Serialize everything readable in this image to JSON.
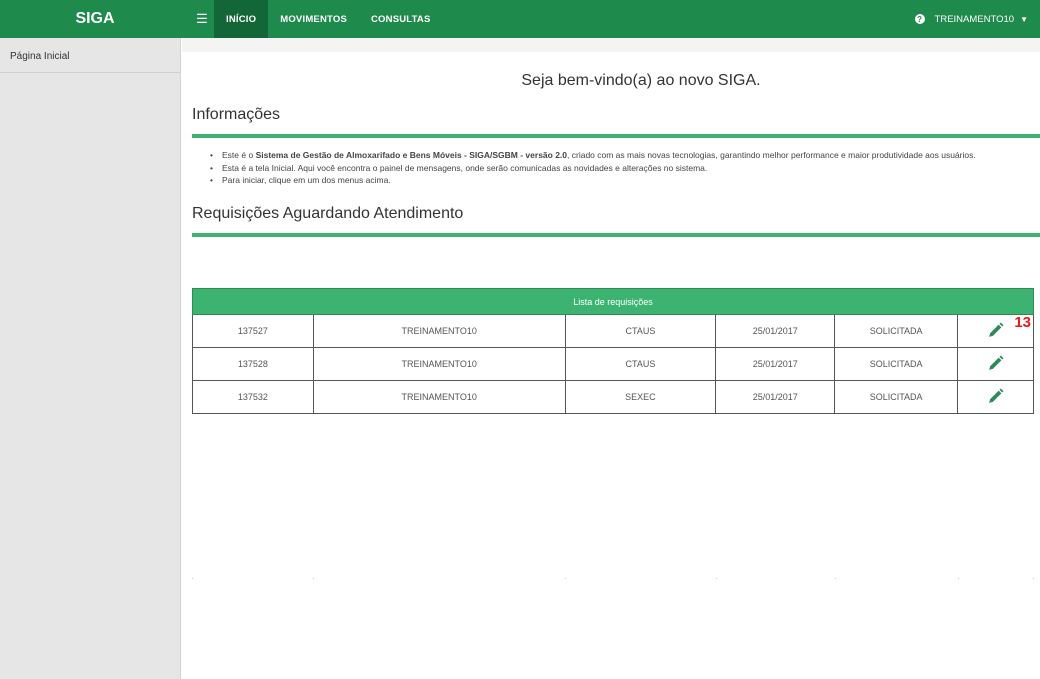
{
  "brand": "SIGA",
  "nav": {
    "items": [
      "INÍCIO",
      "MOVIMENTOS",
      "CONSULTAS"
    ],
    "active": "INÍCIO"
  },
  "user": {
    "name": "TREINAMENTO10"
  },
  "sidebar": {
    "items": [
      {
        "label": "Página Inicial"
      }
    ]
  },
  "main": {
    "welcome": "Seja bem-vindo(a) ao novo SIGA.",
    "info_title": "Informações",
    "bullets": {
      "b1_pre": "Este é o ",
      "b1_bold1": "Sistema de Gestão de Almoxarifado e Bens Móveis - SIGA/SGBM - versão 2.0",
      "b1_post": ", criado com as mais novas tecnologias, garantindo melhor performance e maior produtividade aos usuários.",
      "b2": "Esta é a tela Inicial. Aqui você encontra o painel de mensagens, onde serão comunicadas as novidades e alterações no sistema.",
      "b3": "Para iniciar, clique em um dos menus acima."
    },
    "req_title": "Requisições Aguardando Atendimento",
    "table": {
      "caption": "Lista de requisições",
      "rows": [
        {
          "id": "137527",
          "user": "TREINAMENTO10",
          "unit": "CTAUS",
          "date": "25/01/2017",
          "status": "SOLICITADA"
        },
        {
          "id": "137528",
          "user": "TREINAMENTO10",
          "unit": "CTAUS",
          "date": "25/01/2017",
          "status": "SOLICITADA"
        },
        {
          "id": "137532",
          "user": "TREINAMENTO10",
          "unit": "SEXEC",
          "date": "25/01/2017",
          "status": "SOLICITADA"
        }
      ],
      "row_action_icon": "pencil-icon"
    },
    "annotation": "13"
  },
  "colors": {
    "header": "#1e8a4c",
    "header_active": "#126638",
    "accent": "#3cb371",
    "annotation": "#e31b1b"
  }
}
